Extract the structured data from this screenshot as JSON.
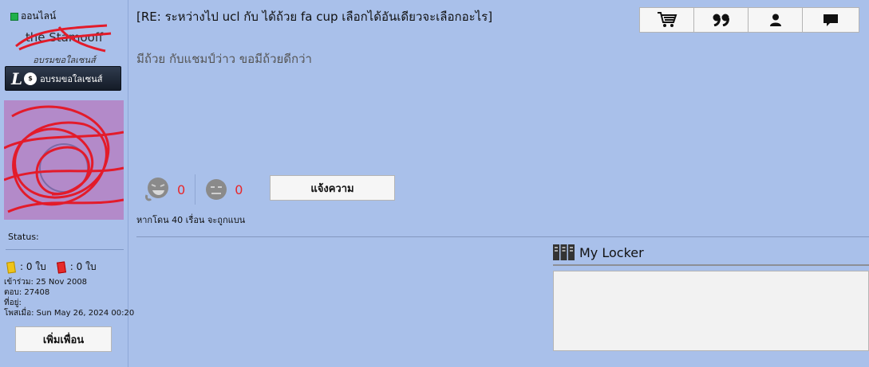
{
  "sidebar": {
    "online_label": "ออนไลน์",
    "username": "the Stamooff",
    "user_title": "อบรมขอใลเซนส์",
    "badge": {
      "letter": "L",
      "coin": "$",
      "text": "อบรมขอใลเซนส์"
    },
    "status_label": "Status:",
    "yellow_cards": ": 0 ใบ",
    "red_cards": ": 0 ใบ",
    "joined": "เข้าร่วม: 25 Nov 2008",
    "replies": "ตอบ: 27408",
    "location": "ที่อยู่:",
    "posted": "โพสเมื่อ: Sun May 26, 2024 00:20",
    "add_friend_label": "เพิ่มเพื่อน"
  },
  "post": {
    "title": "[RE: ระหว่างไป ucl กับ ได้ถ้วย fa cup เลือกได้อันเดียวจะเลือกอะไร]",
    "body": "มีถ้วย กับแชมป์ว่าว ขอมีถ้วยดีกว่า"
  },
  "toolbar": {
    "buttons": [
      {
        "icon": "cart-icon"
      },
      {
        "icon": "quote-icon"
      },
      {
        "icon": "user-icon"
      },
      {
        "icon": "message-icon"
      }
    ]
  },
  "reactions": {
    "like_count": "0",
    "dislike_count": "0",
    "report_label": "แจ้งความ",
    "ban_note": "หากโดน 40 เรื่อน จะถูกแบน"
  },
  "locker": {
    "title": "My Locker"
  },
  "colors": {
    "background": "#a9c0ea",
    "count": "#e8272a",
    "online": "#1fb04a"
  }
}
